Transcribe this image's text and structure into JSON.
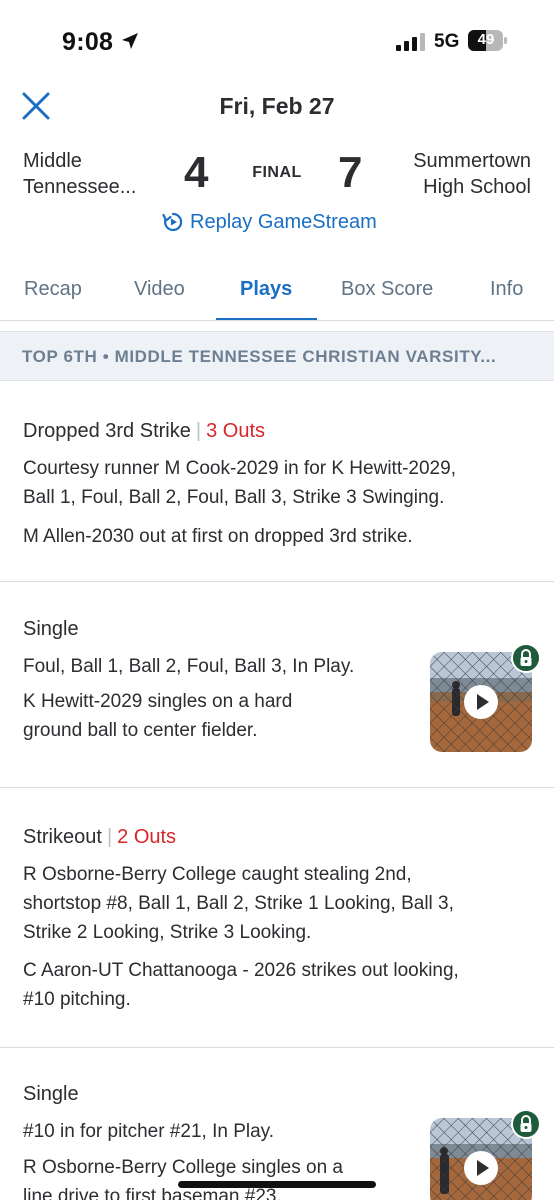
{
  "status_bar": {
    "time": "9:08",
    "network": "5G",
    "battery": "49"
  },
  "header": {
    "date": "Fri, Feb 27"
  },
  "game": {
    "home_team_line1": "Middle",
    "home_team_line2": "Tennessee...",
    "home_score": "4",
    "status": "FINAL",
    "away_score": "7",
    "away_team_line1": "Summertown",
    "away_team_line2": "High School",
    "replay_label": "Replay GameStream"
  },
  "tabs": [
    {
      "label": "Recap"
    },
    {
      "label": "Video"
    },
    {
      "label": "Plays"
    },
    {
      "label": "Box Score"
    },
    {
      "label": "Info"
    }
  ],
  "active_tab": "Plays",
  "inning_header": "TOP 6TH • MIDDLE TENNESSEE CHRISTIAN VARSITY...",
  "plays": [
    {
      "title": "Dropped 3rd Strike",
      "outs": "3 Outs",
      "lines": [
        "Courtesy runner M Cook-2029 in for K Hewitt-2029,",
        "Ball 1, Foul, Ball 2, Foul, Ball 3, Strike 3 Swinging.",
        "M Allen-2030 out at first on dropped 3rd strike."
      ]
    },
    {
      "title": "Single",
      "lines": [
        "Foul, Ball 1, Ball 2, Foul, Ball 3, In Play.",
        "K Hewitt-2029 singles on a hard",
        "ground ball to center fielder."
      ]
    },
    {
      "title": "Strikeout",
      "outs": "2 Outs",
      "lines": [
        "R Osborne-Berry College caught stealing 2nd,",
        "shortstop #8, Ball 1, Ball 2, Strike 1 Looking, Ball 3,",
        "Strike 2 Looking, Strike 3 Looking.",
        "C Aaron-UT Chattanooga - 2026 strikes out looking,",
        "#10 pitching."
      ]
    },
    {
      "title": "Single",
      "lines": [
        "#10 in for pitcher #21, In Play.",
        "R Osborne-Berry College singles on a",
        "line drive to first baseman #23."
      ]
    }
  ],
  "colors": {
    "accent": "#1a6fc4",
    "outs": "#d7262b",
    "tab_inactive": "#5f7387",
    "inning_bg": "#eef1f6",
    "lock_bg": "#1f5a3b"
  },
  "icons": [
    "close-icon",
    "location-arrow-icon",
    "signal-icon",
    "battery-icon",
    "replay-icon",
    "play-icon",
    "lock-icon"
  ]
}
